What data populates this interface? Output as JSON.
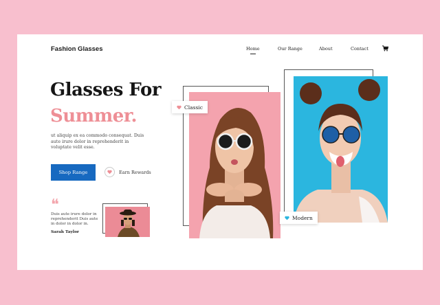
{
  "header": {
    "brand": "Fashion Glasses",
    "nav": [
      {
        "label": "Home",
        "active": true
      },
      {
        "label": "Our Range",
        "active": false
      },
      {
        "label": "About",
        "active": false
      },
      {
        "label": "Contact",
        "active": false
      }
    ],
    "cart_icon": "shopping-cart-icon"
  },
  "hero": {
    "title_line1": "Glasses For",
    "title_line2": "Summer.",
    "description": "ut aliquip ex ea commodo consequat. Duis aute irure dolor in reprehenderit in voluptate velit esse.",
    "cta_label": "Shop Range",
    "rewards_label": "Earn Rewards",
    "rewards_icon": "heart-icon"
  },
  "testimonial": {
    "quote_icon": "quote-icon",
    "text": "Duis aute irure dolor in reprehenderit Duis aute in dolor in dolor in.",
    "author": "Sarah Taylor"
  },
  "gallery": {
    "tag_classic": "Classic",
    "tag_modern": "Modern"
  },
  "colors": {
    "page_bg": "#f8bfce",
    "accent_pink": "#ee8f96",
    "button_blue": "#1769c0",
    "photo_pink": "#f4a3ae",
    "photo_blue": "#2bb6df",
    "modern_heart": "#2bb6df"
  }
}
